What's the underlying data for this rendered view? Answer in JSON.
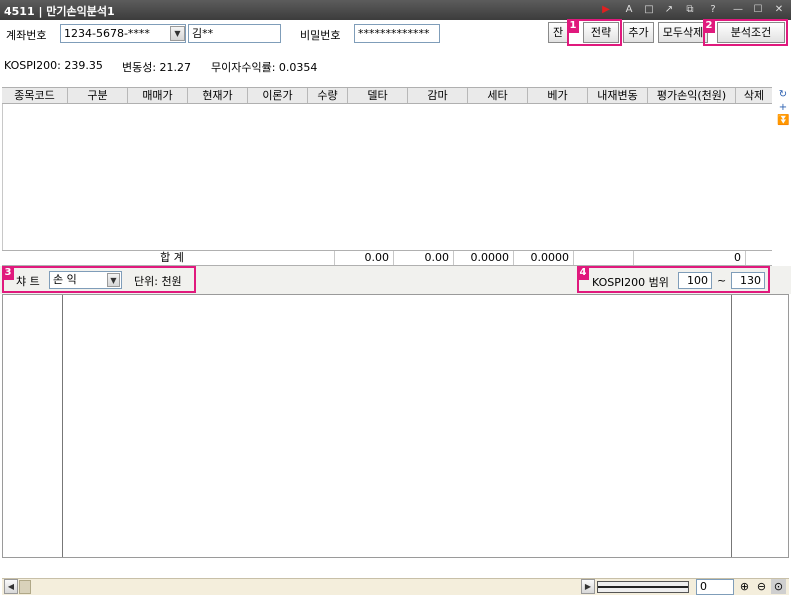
{
  "window": {
    "title": "4511 | 만기손익분석1",
    "controls": [
      "play-icon",
      "font-icon",
      "window-icon",
      "pin-icon",
      "restore-icon",
      "help-icon",
      "minimize-icon",
      "maximize-icon",
      "close-icon"
    ],
    "control_glyphs": [
      "▶",
      "A",
      "□",
      "↗",
      "⧉",
      "?",
      "—",
      "☐",
      "✕"
    ]
  },
  "account": {
    "label": "계좌번호",
    "number": "1234-5678-****",
    "name": "김**",
    "password_label": "비밀번호",
    "password": "*************"
  },
  "buttons": {
    "balance": "잔",
    "strategy": "전략",
    "add": "추가",
    "delete_all": "모두삭제",
    "analysis_condition": "분석조건"
  },
  "badges": [
    "1",
    "2",
    "3",
    "4"
  ],
  "stats": {
    "kospi": "KOSPI200:  239.35",
    "volatility": "변동성: 21.27",
    "risk_free": "무이자수익률: 0.0354"
  },
  "table": {
    "headers": [
      "종목코드",
      "구분",
      "매매가",
      "현재가",
      "이론가",
      "수량",
      "델타",
      "감마",
      "세타",
      "베가",
      "내재변동",
      "평가손익(천원)",
      "삭제"
    ],
    "sum_row": {
      "label": "합 계",
      "delta": "0.00",
      "gamma": "0.00",
      "theta": "0.0000",
      "vega": "0.0000",
      "pnl": "0"
    }
  },
  "chart_controls": {
    "chart_label": "챠 트",
    "chart_type": "손 익",
    "unit": "단위: 천원",
    "range_label": "KOSPI200 범위",
    "range_min": "100",
    "range_sep": "~",
    "range_max": "130"
  },
  "scrollbar": {
    "zoom_value": "0"
  },
  "colors": {
    "highlight": "#e0197d",
    "titlebar": "#4a4a4a"
  }
}
